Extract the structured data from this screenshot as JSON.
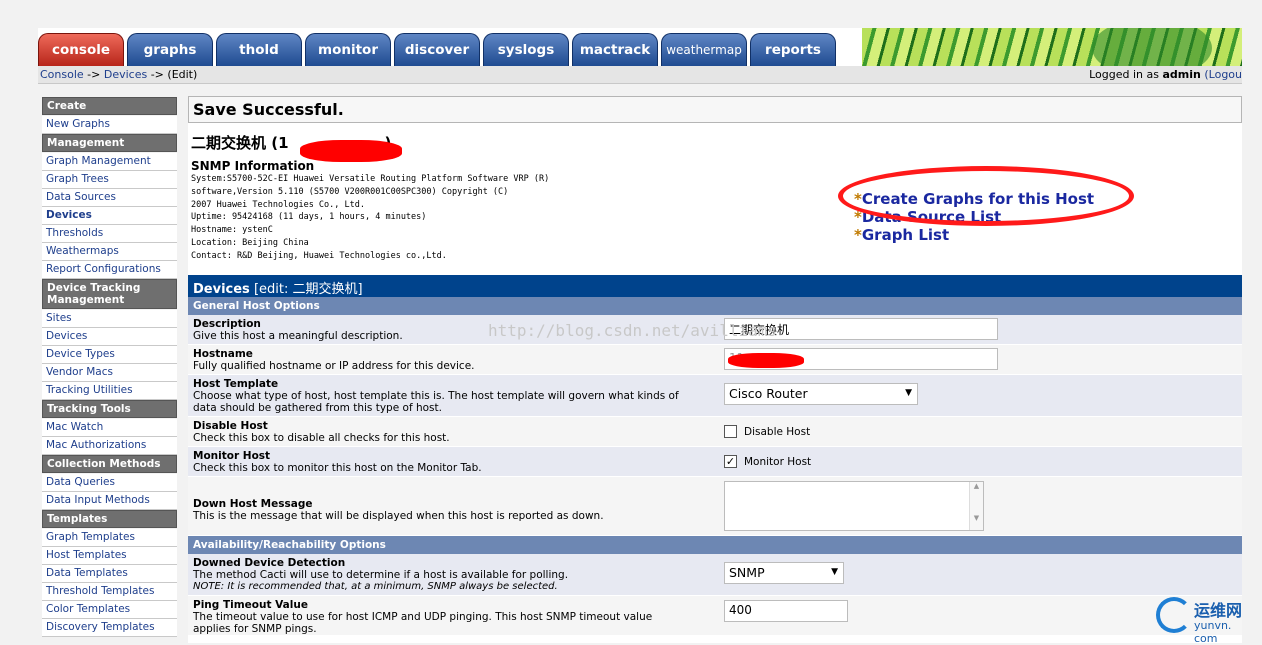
{
  "tabs": [
    {
      "label": "console",
      "active": true
    },
    {
      "label": "graphs"
    },
    {
      "label": "thold"
    },
    {
      "label": "monitor"
    },
    {
      "label": "discover"
    },
    {
      "label": "syslogs"
    },
    {
      "label": "mactrack"
    },
    {
      "label": "weathermap"
    },
    {
      "label": "reports"
    }
  ],
  "breadcrumb": {
    "console": "Console",
    "sep1": " -> ",
    "devices": "Devices",
    "sep2": " -> ",
    "current": "(Edit)"
  },
  "login": {
    "prefix": "Logged in as ",
    "user": "admin",
    "logout": "(Logou"
  },
  "sidebar": {
    "create": "Create",
    "new_graphs": "New Graphs",
    "management": "Management",
    "graph_management": "Graph Management",
    "graph_trees": "Graph Trees",
    "data_sources": "Data Sources",
    "devices": "Devices",
    "thresholds": "Thresholds",
    "weathermaps": "Weathermaps",
    "report_configurations": "Report Configurations",
    "device_tracking_management": "Device Tracking Management",
    "sites": "Sites",
    "devices2": "Devices",
    "device_types": "Device Types",
    "vendor_macs": "Vendor Macs",
    "tracking_utilities": "Tracking Utilities",
    "tracking_tools": "Tracking Tools",
    "mac_watch": "Mac Watch",
    "mac_authorizations": "Mac Authorizations",
    "collection_methods": "Collection Methods",
    "data_queries": "Data Queries",
    "data_input_methods": "Data Input Methods",
    "templates": "Templates",
    "graph_templates": "Graph Templates",
    "host_templates": "Host Templates",
    "data_templates": "Data Templates",
    "threshold_templates": "Threshold Templates",
    "color_templates": "Color Templates",
    "discovery_templates": "Discovery Templates"
  },
  "message": "Save Successful.",
  "device": {
    "title_prefix": "二期交换机 (1",
    "title_suffix": ")",
    "snmp_title": "SNMP Information",
    "snmp_lines": [
      "System:S5700-52C-EI Huawei Versatile Routing Platform Software VRP (R)",
      "software,Version 5.110 (S5700 V200R001C00SPC300) Copyright (C)",
      "2007 Huawei Technologies Co., Ltd.",
      "Uptime: 95424168 (11 days, 1 hours, 4 minutes)",
      "Hostname: ystenC",
      "Location: Beijing China",
      "Contact: R&D Beijing, Huawei Technologies co.,Ltd."
    ]
  },
  "links": {
    "star": "*",
    "create_graphs": "Create Graphs for this Host",
    "data_source_list": "Data Source List",
    "graph_list": "Graph List"
  },
  "panel": {
    "title": "Devices",
    "edit": " [edit: 二期交换机]"
  },
  "general": {
    "heading": "General Host Options",
    "description": {
      "label": "Description",
      "help": "Give this host a meaningful description.",
      "value": "二期交换机"
    },
    "hostname": {
      "label": "Hostname",
      "help": "Fully qualified hostname or IP address for this device.",
      "value": "11..."
    },
    "host_template": {
      "label": "Host Template",
      "help1": "Choose what type of host, host template this is. The host template will govern what kinds of",
      "help2": "data should be gathered from this type of host.",
      "value": "Cisco Router"
    },
    "disable_host": {
      "label": "Disable Host",
      "help": "Check this box to disable all checks for this host.",
      "check_label": "Disable Host"
    },
    "monitor_host": {
      "label": "Monitor Host",
      "help": "Check this box to monitor this host on the Monitor Tab.",
      "check_label": "Monitor Host",
      "checkmark": "✓"
    },
    "down_msg": {
      "label": "Down Host Message",
      "help": "This is the message that will be displayed when this host is reported as down."
    }
  },
  "availability": {
    "heading": "Availability/Reachability Options",
    "detection": {
      "label": "Downed Device Detection",
      "help": "The method Cacti will use to determine if a host is available for polling.",
      "note": "NOTE: It is recommended that, at a minimum, SNMP always be selected.",
      "value": "SNMP"
    },
    "ping_timeout": {
      "label": "Ping Timeout Value",
      "help1": "The timeout value to use for host ICMP and UDP pinging. This host SNMP timeout value",
      "help2": "applies for SNMP pings.",
      "value": "400"
    }
  },
  "watermark": "http://blog.csdn.net/avilliams",
  "logo": {
    "cn": "运维网",
    "en": "yunvn. com"
  },
  "colors": {
    "header_blue": "#00438c",
    "tab_blue": "#1f4b91",
    "tab_red": "#b7251a",
    "annotation_red": "#ff1a1a"
  }
}
